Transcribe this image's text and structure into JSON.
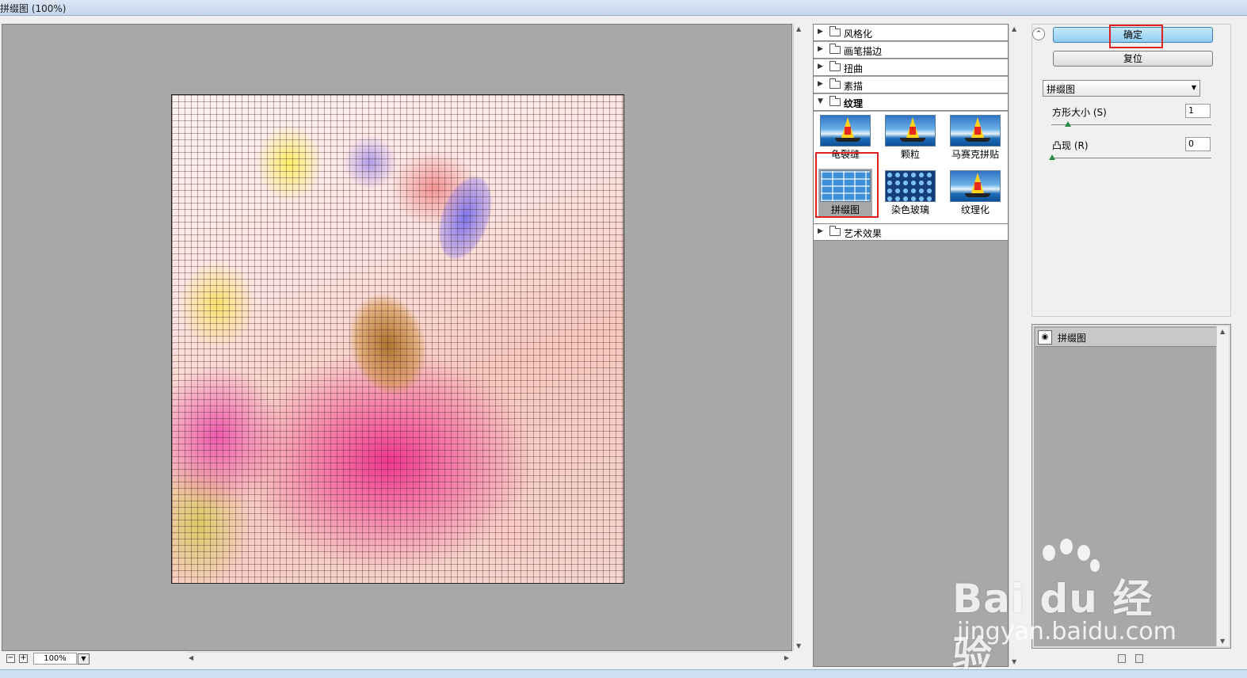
{
  "window": {
    "title": "拼缀图 (100%)"
  },
  "preview": {
    "zoom": "100%"
  },
  "gallery": {
    "categories": [
      {
        "label": "风格化"
      },
      {
        "label": "画笔描边"
      },
      {
        "label": "扭曲"
      },
      {
        "label": "素描"
      },
      {
        "label": "纹理"
      },
      {
        "label": "艺术效果"
      }
    ],
    "texture_filters": [
      {
        "label": "龟裂缝"
      },
      {
        "label": "颗粒"
      },
      {
        "label": "马赛克拼贴"
      },
      {
        "label": "拼缀图"
      },
      {
        "label": "染色玻璃"
      },
      {
        "label": "纹理化"
      }
    ],
    "selected": "拼缀图"
  },
  "controls": {
    "ok_label": "确定",
    "reset_label": "复位",
    "filter_select": "拼缀图",
    "square_size_label": "方形大小 (S)",
    "square_size_value": "1",
    "relief_label": "凸现 (R)",
    "relief_value": "0"
  },
  "layers": {
    "items": [
      {
        "label": "拼缀图"
      }
    ]
  },
  "watermark": {
    "brand": "Bai du 经验",
    "url": "jingyan.baidu.com"
  },
  "colors": {
    "highlight": "#e02020",
    "ok_button": "#8fcdf0",
    "canvas_bg": "#a8a8a8"
  },
  "icons": [
    "expand-triangle-icon",
    "folder-icon",
    "collapse-icon",
    "eye-icon",
    "new-layer-icon",
    "delete-layer-icon",
    "zoom-out-icon",
    "zoom-in-icon"
  ]
}
